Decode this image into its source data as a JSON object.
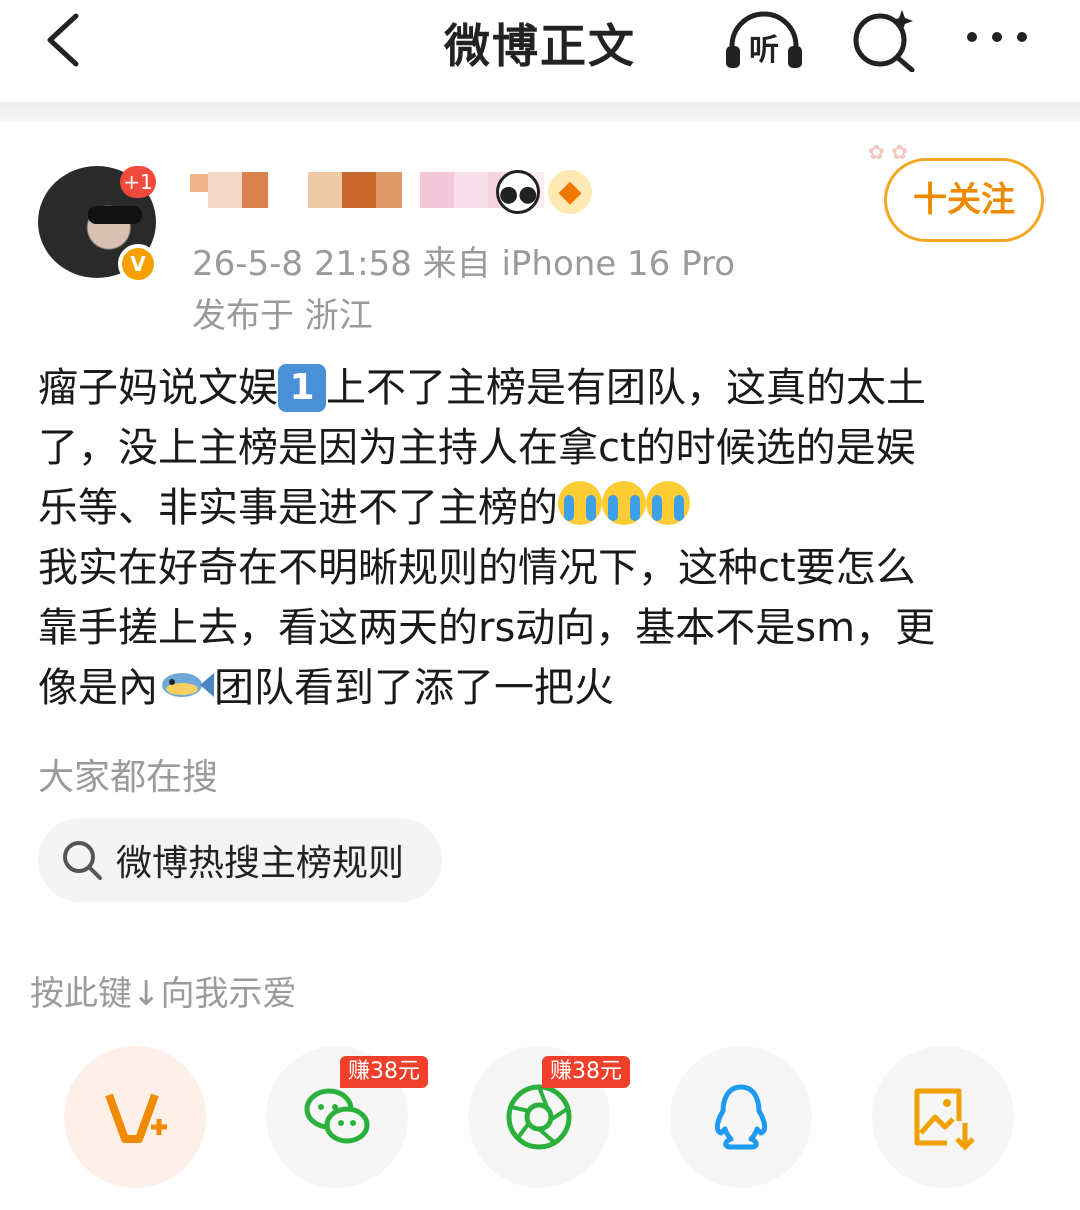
{
  "header": {
    "title": "微博正文",
    "back_icon": "chevron-left-icon",
    "listen_icon": "headphones-listen-icon",
    "search_icon": "search-sparkle-icon",
    "more_icon": "more-dots-icon"
  },
  "author": {
    "avatar_badge": "+1",
    "verified_mark": "V",
    "time_source": "26-5-8 21:58   来自 iPhone 16 Pro",
    "location": "发布于 浙江",
    "follow_label": "十关注"
  },
  "post": {
    "line1_a": "瘤子妈说文娱",
    "line1_badge": "1",
    "line1_b": "上不了主榜是有团队，这真的太土",
    "line2": "了，没上主榜是因为主持人在拿ct的时候选的是娱",
    "line3": "乐等、非实事是进不了主榜的",
    "line4": "我实在好奇在不明晰规则的情况下，这种ct要怎么",
    "line5": "靠手搓上去，看这两天的rs动向，基本不是sm，更",
    "line6_a": "像是內",
    "line6_b": "团队看到了添了一把火"
  },
  "search": {
    "title": "大家都在搜",
    "chip": "微博热搜主榜规则"
  },
  "share": {
    "hint": "按此键↓向我示爱",
    "reward_wechat": "赚38元",
    "reward_moments": "赚38元"
  },
  "colors": {
    "accent_orange": "#ee8a00",
    "reward_red": "#f0402b",
    "wechat_green": "#2bb03b",
    "qq_blue": "#1e9bf0"
  }
}
